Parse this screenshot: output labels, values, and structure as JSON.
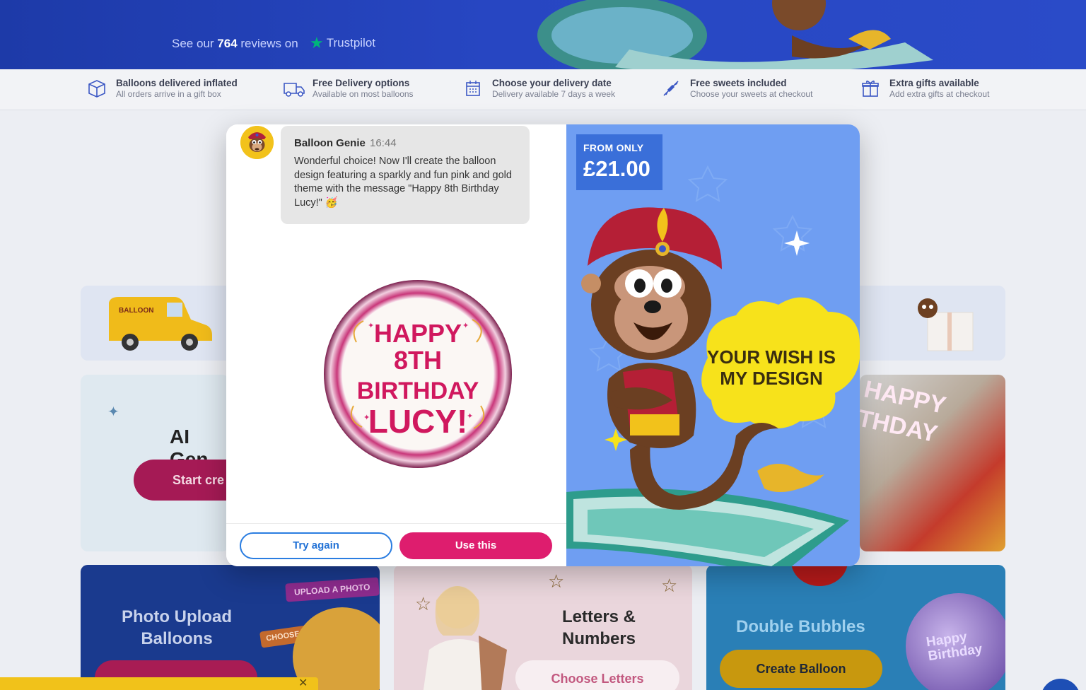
{
  "hero": {
    "reviews_prefix": "See our",
    "reviews_count": "764",
    "reviews_suffix": "reviews on",
    "trustpilot_label": "Trustpilot"
  },
  "features": [
    {
      "icon": "box-icon",
      "title": "Balloons delivered inflated",
      "subtitle": "All orders arrive in a gift box"
    },
    {
      "icon": "truck-icon",
      "title": "Free Delivery options",
      "subtitle": "Available on most balloons"
    },
    {
      "icon": "calendar-icon",
      "title": "Choose your delivery date",
      "subtitle": "Delivery available 7 days a week"
    },
    {
      "icon": "candy-icon",
      "title": "Free sweets included",
      "subtitle": "Choose your sweets at checkout"
    },
    {
      "icon": "gift-icon",
      "title": "Extra gifts available",
      "subtitle": "Add extra gifts at checkout"
    }
  ],
  "background": {
    "ai_title": "AI Gen",
    "ai_button": "Start cre",
    "photo_title": "Photo Upload Balloons",
    "photo_tag": "UPLOAD A PHOTO",
    "photo_tag2": "CHOOSE A BORDER",
    "letters_title": "Letters & Numbers",
    "letters_button": "Choose Letters",
    "bubbles_title": "Double Bubbles",
    "bubbles_button": "Create Balloon",
    "bubble_text": "Happy Birthday",
    "right_card_text": "HAPPY THDAY"
  },
  "modal": {
    "chat": {
      "sender": "Balloon Genie",
      "time": "16:44",
      "message": "Wonderful choice! Now I'll create the balloon design featuring a sparkly and fun pink and gold theme with the message \"Happy 8th Birthday Lucy!\" 🥳",
      "balloon_lines": [
        "HAPPY",
        "8TH",
        "BIRTHDAY",
        "LUCY!"
      ]
    },
    "buttons": {
      "try_again": "Try again",
      "use_this": "Use this"
    },
    "promo": {
      "from_label": "FROM ONLY",
      "price": "£21.00",
      "tagline_line1": "YOUR WISH IS",
      "tagline_line2": "MY DESIGN"
    }
  },
  "colors": {
    "accent_pink": "#de1d6e",
    "accent_blue": "#2272d6",
    "promo_bg": "#6f9ef2",
    "price_bg": "#3a6fd9",
    "hero_blue": "#2746c2"
  }
}
